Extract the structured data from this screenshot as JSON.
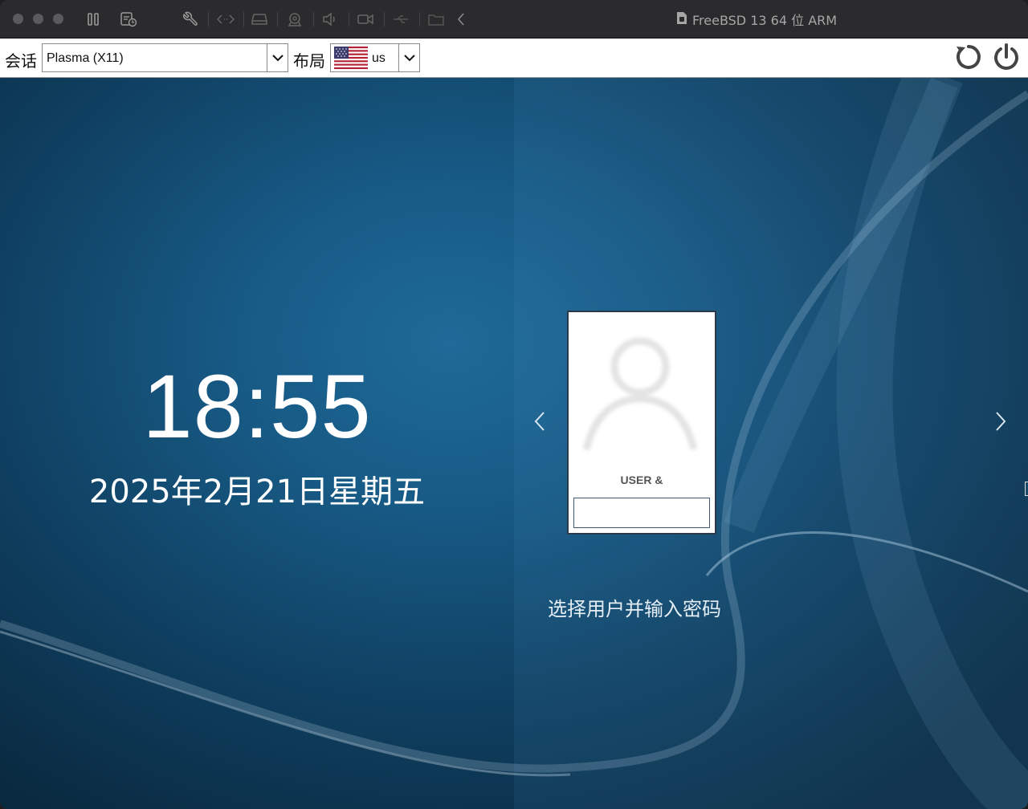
{
  "window": {
    "title": "FreeBSD 13 64 位 ARM"
  },
  "toolbar_icons": [
    "pause-icon",
    "snapshot-icon",
    "wrench-icon",
    "code-arrows-icon",
    "disk-icon",
    "camera-icon",
    "audio-icon",
    "video-icon",
    "usb-icon",
    "folder-share-icon",
    "chevron-left-icon"
  ],
  "sddm_bar": {
    "session_label": "会话",
    "session_value": "Plasma (X11)",
    "layout_label": "布局",
    "layout_value": "us",
    "layout_flag": "us-flag",
    "reboot_icon": "reboot-icon",
    "shutdown_icon": "power-icon"
  },
  "clock": {
    "time": "18:55",
    "date": "2025年2月21日星期五"
  },
  "login": {
    "user_name": "USER &",
    "password_value": "",
    "hint": "选择用户并输入密码"
  },
  "colors": {
    "titlebar": "#2b2b2d",
    "desktop_accent": "#1f6a98",
    "card_border": "#2a3a4a"
  }
}
